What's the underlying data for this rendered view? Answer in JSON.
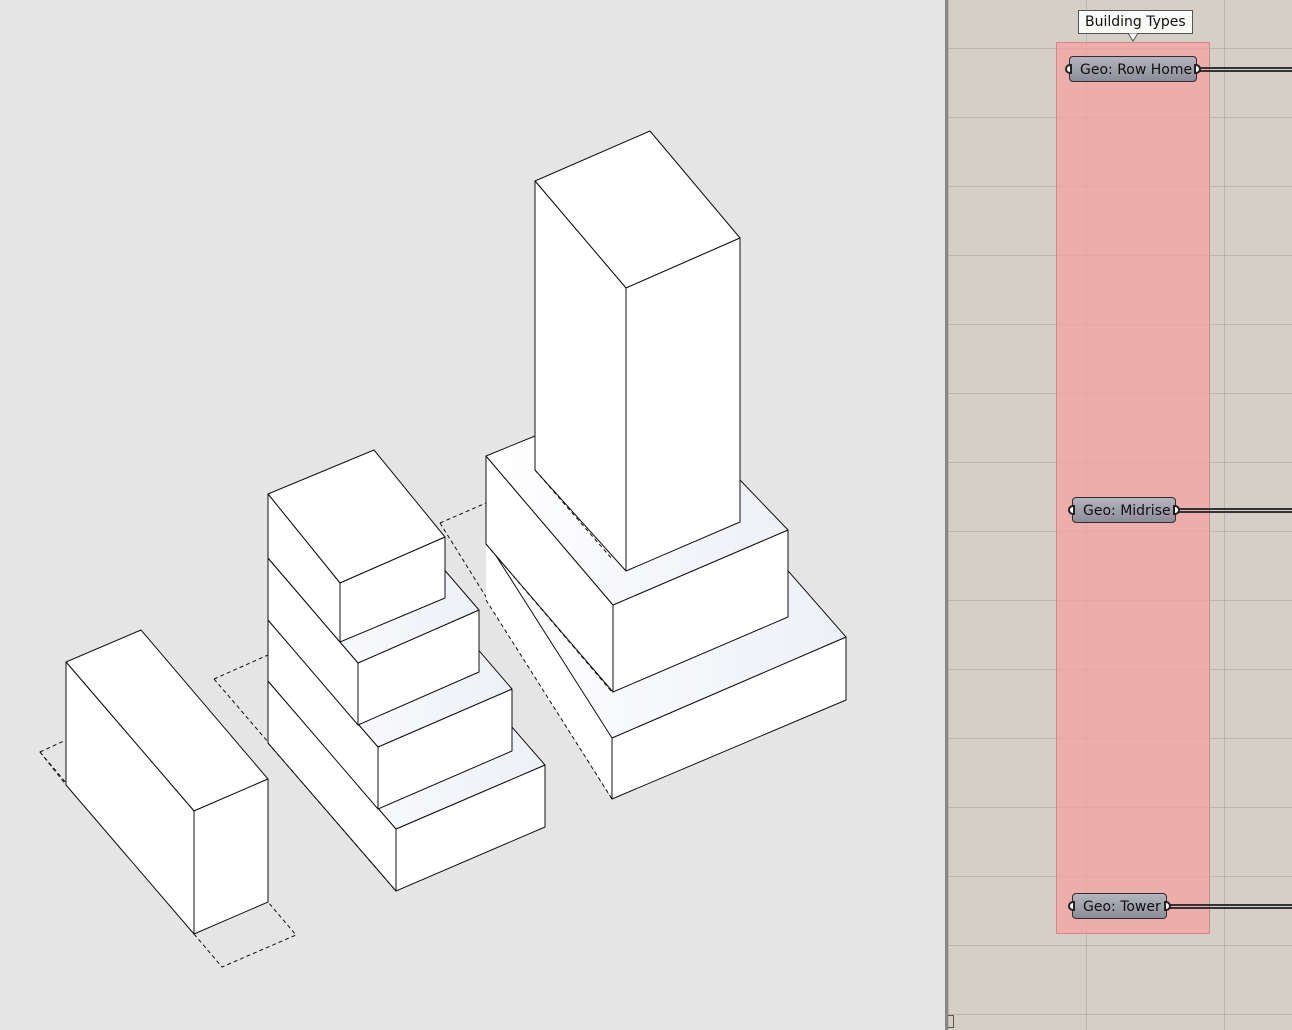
{
  "viewport": {
    "background": "#e5e5e5",
    "massing_fill": "#ffffff",
    "edge_color": "#000000"
  },
  "canvas": {
    "background": "#d4d0c8",
    "group": {
      "label": "Building Types",
      "color": "#f0a0a0"
    },
    "nodes": [
      {
        "label": "Geo: Row Home"
      },
      {
        "label": "Geo: Midrise"
      },
      {
        "label": "Geo: Tower"
      }
    ]
  }
}
